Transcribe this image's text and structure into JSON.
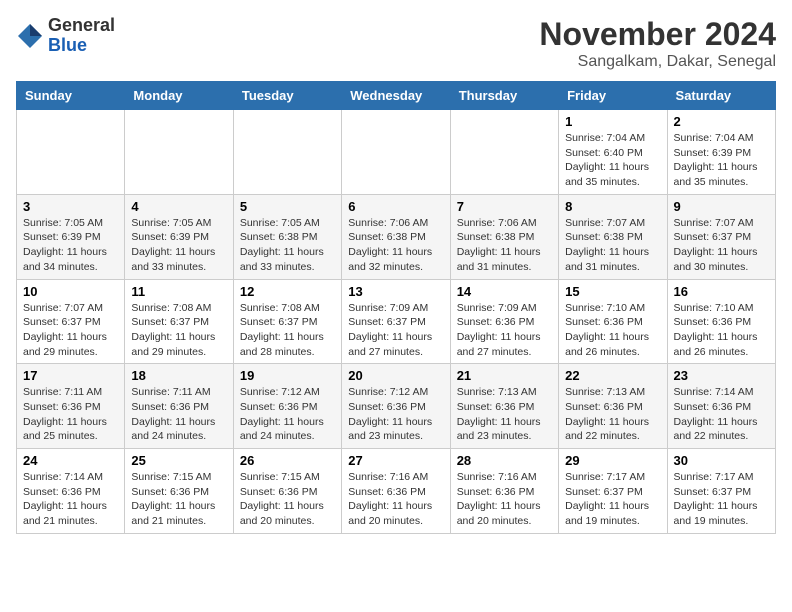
{
  "logo": {
    "general": "General",
    "blue": "Blue"
  },
  "title": "November 2024",
  "location": "Sangalkam, Dakar, Senegal",
  "weekdays": [
    "Sunday",
    "Monday",
    "Tuesday",
    "Wednesday",
    "Thursday",
    "Friday",
    "Saturday"
  ],
  "weeks": [
    [
      {
        "day": "",
        "info": ""
      },
      {
        "day": "",
        "info": ""
      },
      {
        "day": "",
        "info": ""
      },
      {
        "day": "",
        "info": ""
      },
      {
        "day": "",
        "info": ""
      },
      {
        "day": "1",
        "info": "Sunrise: 7:04 AM\nSunset: 6:40 PM\nDaylight: 11 hours and 35 minutes."
      },
      {
        "day": "2",
        "info": "Sunrise: 7:04 AM\nSunset: 6:39 PM\nDaylight: 11 hours and 35 minutes."
      }
    ],
    [
      {
        "day": "3",
        "info": "Sunrise: 7:05 AM\nSunset: 6:39 PM\nDaylight: 11 hours and 34 minutes."
      },
      {
        "day": "4",
        "info": "Sunrise: 7:05 AM\nSunset: 6:39 PM\nDaylight: 11 hours and 33 minutes."
      },
      {
        "day": "5",
        "info": "Sunrise: 7:05 AM\nSunset: 6:38 PM\nDaylight: 11 hours and 33 minutes."
      },
      {
        "day": "6",
        "info": "Sunrise: 7:06 AM\nSunset: 6:38 PM\nDaylight: 11 hours and 32 minutes."
      },
      {
        "day": "7",
        "info": "Sunrise: 7:06 AM\nSunset: 6:38 PM\nDaylight: 11 hours and 31 minutes."
      },
      {
        "day": "8",
        "info": "Sunrise: 7:07 AM\nSunset: 6:38 PM\nDaylight: 11 hours and 31 minutes."
      },
      {
        "day": "9",
        "info": "Sunrise: 7:07 AM\nSunset: 6:37 PM\nDaylight: 11 hours and 30 minutes."
      }
    ],
    [
      {
        "day": "10",
        "info": "Sunrise: 7:07 AM\nSunset: 6:37 PM\nDaylight: 11 hours and 29 minutes."
      },
      {
        "day": "11",
        "info": "Sunrise: 7:08 AM\nSunset: 6:37 PM\nDaylight: 11 hours and 29 minutes."
      },
      {
        "day": "12",
        "info": "Sunrise: 7:08 AM\nSunset: 6:37 PM\nDaylight: 11 hours and 28 minutes."
      },
      {
        "day": "13",
        "info": "Sunrise: 7:09 AM\nSunset: 6:37 PM\nDaylight: 11 hours and 27 minutes."
      },
      {
        "day": "14",
        "info": "Sunrise: 7:09 AM\nSunset: 6:36 PM\nDaylight: 11 hours and 27 minutes."
      },
      {
        "day": "15",
        "info": "Sunrise: 7:10 AM\nSunset: 6:36 PM\nDaylight: 11 hours and 26 minutes."
      },
      {
        "day": "16",
        "info": "Sunrise: 7:10 AM\nSunset: 6:36 PM\nDaylight: 11 hours and 26 minutes."
      }
    ],
    [
      {
        "day": "17",
        "info": "Sunrise: 7:11 AM\nSunset: 6:36 PM\nDaylight: 11 hours and 25 minutes."
      },
      {
        "day": "18",
        "info": "Sunrise: 7:11 AM\nSunset: 6:36 PM\nDaylight: 11 hours and 24 minutes."
      },
      {
        "day": "19",
        "info": "Sunrise: 7:12 AM\nSunset: 6:36 PM\nDaylight: 11 hours and 24 minutes."
      },
      {
        "day": "20",
        "info": "Sunrise: 7:12 AM\nSunset: 6:36 PM\nDaylight: 11 hours and 23 minutes."
      },
      {
        "day": "21",
        "info": "Sunrise: 7:13 AM\nSunset: 6:36 PM\nDaylight: 11 hours and 23 minutes."
      },
      {
        "day": "22",
        "info": "Sunrise: 7:13 AM\nSunset: 6:36 PM\nDaylight: 11 hours and 22 minutes."
      },
      {
        "day": "23",
        "info": "Sunrise: 7:14 AM\nSunset: 6:36 PM\nDaylight: 11 hours and 22 minutes."
      }
    ],
    [
      {
        "day": "24",
        "info": "Sunrise: 7:14 AM\nSunset: 6:36 PM\nDaylight: 11 hours and 21 minutes."
      },
      {
        "day": "25",
        "info": "Sunrise: 7:15 AM\nSunset: 6:36 PM\nDaylight: 11 hours and 21 minutes."
      },
      {
        "day": "26",
        "info": "Sunrise: 7:15 AM\nSunset: 6:36 PM\nDaylight: 11 hours and 20 minutes."
      },
      {
        "day": "27",
        "info": "Sunrise: 7:16 AM\nSunset: 6:36 PM\nDaylight: 11 hours and 20 minutes."
      },
      {
        "day": "28",
        "info": "Sunrise: 7:16 AM\nSunset: 6:36 PM\nDaylight: 11 hours and 20 minutes."
      },
      {
        "day": "29",
        "info": "Sunrise: 7:17 AM\nSunset: 6:37 PM\nDaylight: 11 hours and 19 minutes."
      },
      {
        "day": "30",
        "info": "Sunrise: 7:17 AM\nSunset: 6:37 PM\nDaylight: 11 hours and 19 minutes."
      }
    ]
  ]
}
